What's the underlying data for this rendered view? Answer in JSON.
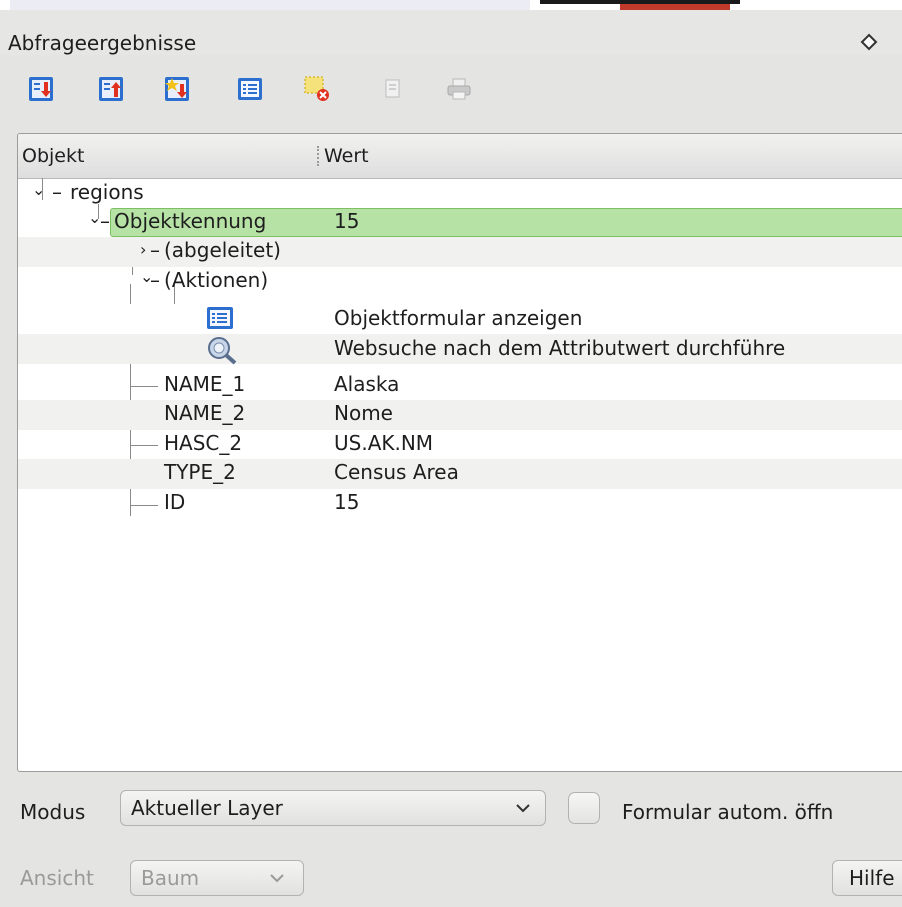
{
  "window": {
    "title": "Abfrageergebnisse"
  },
  "toolbar": {
    "buttons": [
      {
        "name": "expand-tree-icon",
        "enabled": true
      },
      {
        "name": "collapse-tree-icon",
        "enabled": true
      },
      {
        "name": "expand-new-results-icon",
        "enabled": true
      },
      {
        "name": "open-form-icon",
        "enabled": true
      },
      {
        "name": "clear-highlights-icon",
        "enabled": true
      },
      {
        "name": "copy-icon",
        "enabled": false
      },
      {
        "name": "print-icon",
        "enabled": false
      }
    ]
  },
  "tree": {
    "headers": {
      "object": "Objekt",
      "value": "Wert"
    },
    "layer": "regions",
    "feature_label": "Objektkennung",
    "feature_value": "15",
    "derived_label": "(abgeleitet)",
    "actions_label": "(Aktionen)",
    "actions": [
      {
        "label": "Objektformular anzeigen",
        "icon": "form-icon"
      },
      {
        "label": "Websuche nach dem Attributwert durchführe",
        "icon": "web-search-icon"
      }
    ],
    "attributes": [
      {
        "name": "NAME_1",
        "value": "Alaska"
      },
      {
        "name": "NAME_2",
        "value": "Nome"
      },
      {
        "name": "HASC_2",
        "value": "US.AK.NM"
      },
      {
        "name": "TYPE_2",
        "value": "Census Area"
      },
      {
        "name": "ID",
        "value": "15"
      }
    ]
  },
  "footer": {
    "mode_label": "Modus",
    "mode_value": "Aktueller Layer",
    "auto_open_label": "Formular autom. öffn",
    "view_label": "Ansicht",
    "view_value": "Baum",
    "help_label": "Hilfe"
  },
  "colors": {
    "selection": "#b7e2a5",
    "selection_border": "#7cc063",
    "panel": "#e4e4e2"
  }
}
